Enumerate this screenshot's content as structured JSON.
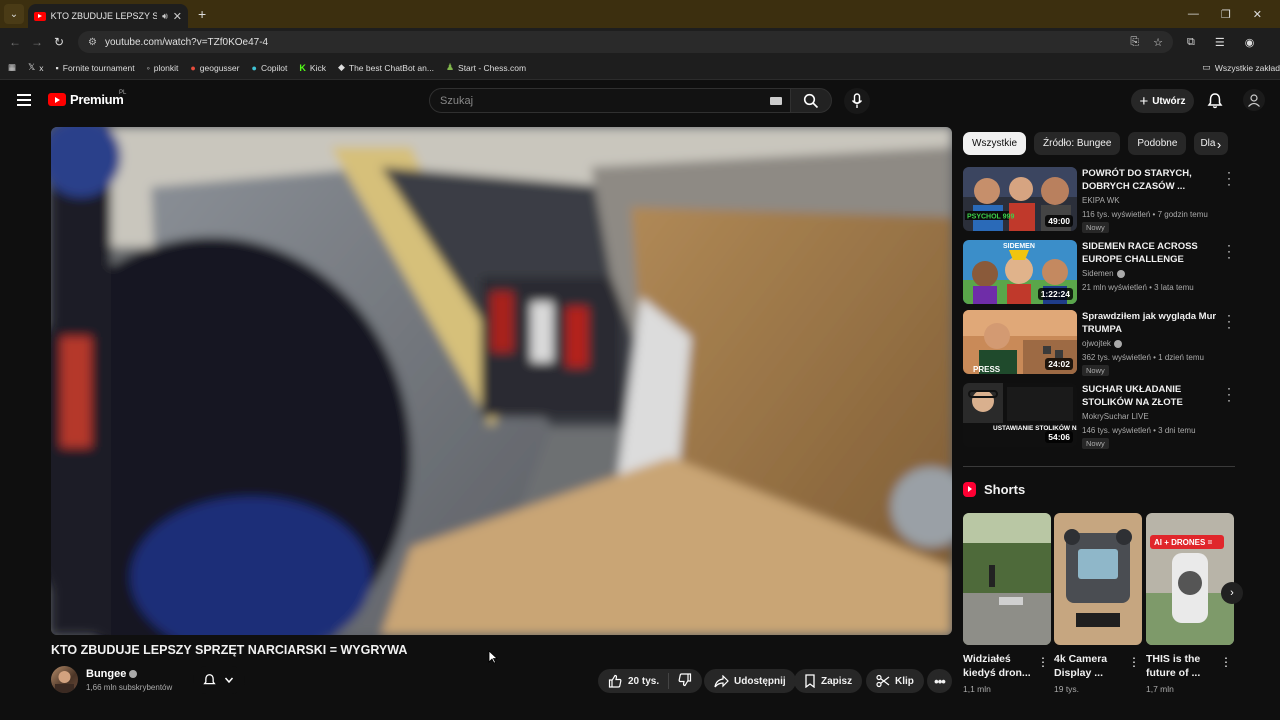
{
  "browser": {
    "tab_title": "KTO ZBUDUJE LEPSZY SPRZ",
    "url": "youtube.com/watch?v=TZf0KOe47-4",
    "bookmarks": [
      {
        "label": "x",
        "icon": "x-icon"
      },
      {
        "label": "Fornite tournament",
        "icon": "game-icon"
      },
      {
        "label": "plonkit",
        "icon": "globe-icon"
      },
      {
        "label": "geogusser",
        "icon": "pin-icon"
      },
      {
        "label": "Copilot",
        "icon": "copilot-icon"
      },
      {
        "label": "Kick",
        "icon": "kick-icon"
      },
      {
        "label": "The best ChatBot an...",
        "icon": "chatbot-icon"
      },
      {
        "label": "Start - Chess.com",
        "icon": "chess-icon"
      }
    ],
    "bookmarks_folder": "Wszystkie zakład"
  },
  "header": {
    "logo_text": "Premium",
    "country": "PL",
    "search_placeholder": "Szukaj",
    "create_label": "Utwórz"
  },
  "video": {
    "title": "KTO ZBUDUJE LEPSZY SPRZĘT NARCIARSKI = WYGRYWA",
    "channel": "Bungee",
    "subscribers": "1,66 mln subskrybentów",
    "likes": "20 tys.",
    "share": "Udostępnij",
    "save": "Zapisz",
    "clip": "Klip"
  },
  "chips": [
    "Wszystkie",
    "Źródło: Bungee",
    "Podobne",
    "Dla"
  ],
  "recommendations": [
    {
      "title": "POWRÓT DO STARYCH, DOBRYCH CZASÓW ...",
      "channel": "EKIPA WK",
      "meta": "116 tys. wyświetleń • 7 godzin temu",
      "badge": "Nowy",
      "duration": "49:00",
      "verified": false
    },
    {
      "title": "SIDEMEN RACE ACROSS EUROPE CHALLENGE",
      "channel": "Sidemen",
      "meta": "21 mln wyświetleń • 3 lata temu",
      "badge": "",
      "duration": "1:22:24",
      "verified": true
    },
    {
      "title": "Sprawdziłem jak wygląda Mur TRUMPA",
      "channel": "ojwojtek",
      "meta": "362 tys. wyświetleń • 1 dzień temu",
      "badge": "Nowy",
      "duration": "24:02",
      "verified": true
    },
    {
      "title": "SUCHAR UKŁADANIE STOLIKÓW NA ZŁOTE ANTOSI...",
      "channel": "MokrySuchar LIVE",
      "meta": "146 tys. wyświetleń • 3 dni temu",
      "badge": "Nowy",
      "duration": "54:06",
      "verified": false
    }
  ],
  "thumb_text": [
    "PSYCHOL 999",
    "SIDEMEN",
    "PRESS",
    "USTAWIANIE STOLIKÓW NA ZŁOTE AN"
  ],
  "shorts": {
    "heading": "Shorts",
    "items": [
      {
        "title": "Widziałeś kiedyś dron...",
        "views": "1,1 mln"
      },
      {
        "title": "4k Camera Display ...",
        "views": "19 tys."
      },
      {
        "title": "THIS is the future of ...",
        "views": "1,7 mln"
      }
    ],
    "short3_overlay": "AI + DRONES ="
  }
}
